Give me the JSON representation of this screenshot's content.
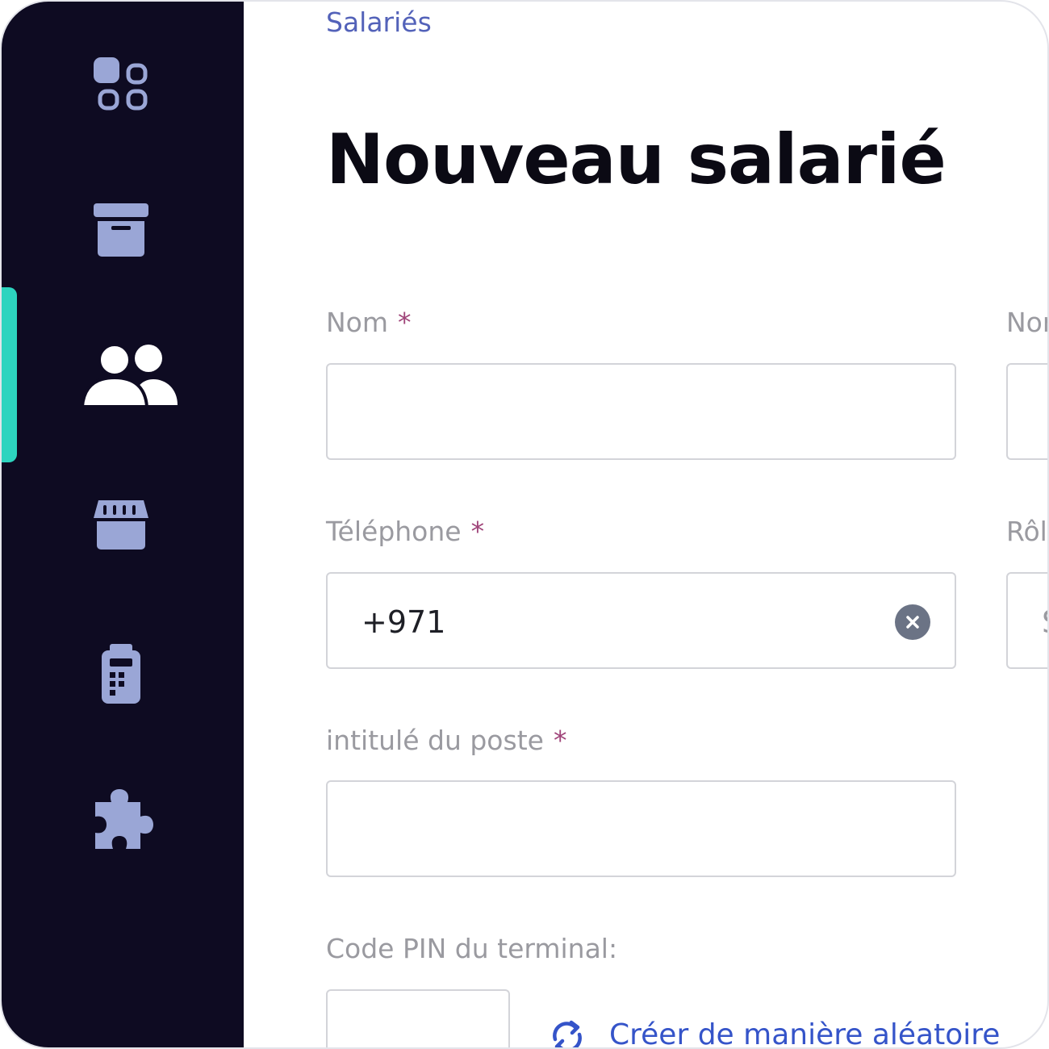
{
  "sidebar": {
    "items": [
      {
        "name": "dashboard",
        "icon": "apps-grid-icon",
        "active": false
      },
      {
        "name": "archive",
        "icon": "archive-box-icon",
        "active": false
      },
      {
        "name": "employees",
        "icon": "users-icon",
        "active": true
      },
      {
        "name": "store",
        "icon": "storefront-icon",
        "active": false
      },
      {
        "name": "terminal",
        "icon": "payment-terminal-icon",
        "active": false
      },
      {
        "name": "integrations",
        "icon": "puzzle-piece-icon",
        "active": false
      }
    ],
    "active_color": "#2dd4bf",
    "background": "#0e0b22",
    "icon_color": "#9aa6d6"
  },
  "header": {
    "breadcrumb": "Salariés",
    "title": "Nouveau salarié"
  },
  "form": {
    "last_name": {
      "label": "Nom",
      "required_mark": "*",
      "value": ""
    },
    "first_name_label_partial": "Nor",
    "phone": {
      "label": "Téléphone",
      "required_mark": "*",
      "value": "+971"
    },
    "role_label_partial": "Rôl",
    "role_value_partial": "S",
    "job_title": {
      "label": "intitulé du poste",
      "required_mark": "*",
      "value": ""
    },
    "pin": {
      "label": "Code PIN du terminal:",
      "value": ""
    },
    "random_button": "Créer de manière aléatoire"
  },
  "colors": {
    "accent": "#3554c9",
    "required": "#a0457a",
    "label": "#9a9aa0"
  }
}
